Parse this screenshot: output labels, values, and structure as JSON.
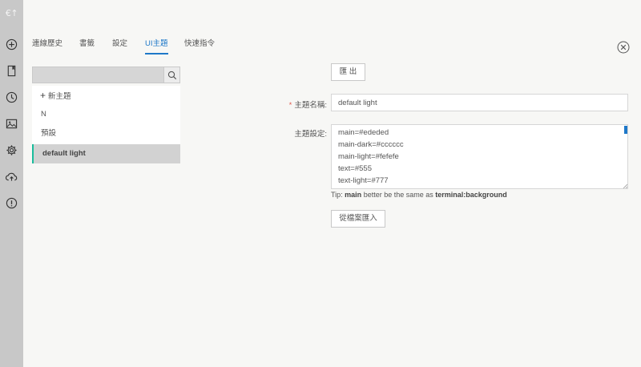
{
  "sidebar": {
    "logo": "€↑",
    "icons": [
      "plus-circle-icon",
      "bookmark-icon",
      "clock-icon",
      "image-icon",
      "gear-icon",
      "cloud-upload-icon",
      "info-icon"
    ]
  },
  "tabs": [
    {
      "label": "連線歷史",
      "active": false
    },
    {
      "label": "書籤",
      "active": false
    },
    {
      "label": "設定",
      "active": false
    },
    {
      "label": "UI主題",
      "active": true
    },
    {
      "label": "快速指令",
      "active": false
    }
  ],
  "theme_list": {
    "search_value": "",
    "new_theme_label": "新主題",
    "items": [
      {
        "label": "N",
        "selected": false
      },
      {
        "label": "預設",
        "selected": false
      },
      {
        "label": "default light",
        "selected": true
      }
    ]
  },
  "form": {
    "export_label": "匯 出",
    "name_label": "主題名稱:",
    "name_value": "default light",
    "config_label": "主題設定:",
    "config_lines": [
      "main=#ededed",
      "main-dark=#cccccc",
      "main-light=#fefefe",
      "text=#555",
      "text-light=#777"
    ],
    "tip_prefix": "Tip: ",
    "tip_bold1": "main",
    "tip_middle": " better be the same as ",
    "tip_bold2": "terminal:background",
    "import_label": "從檔案匯入"
  },
  "colors": {
    "accent": "#1e78c8",
    "selected_marker": "#1abc9c",
    "rail_bg": "#c8c8c8",
    "required": "#e05a4e"
  }
}
